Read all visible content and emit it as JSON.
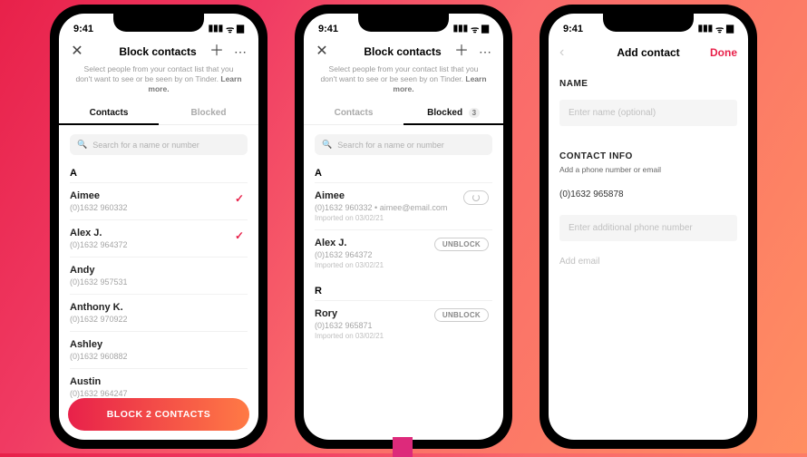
{
  "status_bar": {
    "time": "9:41"
  },
  "common": {
    "title": "Block contacts",
    "subtitle_a": "Select people from your contact list that you don't want to see or be seen by on Tinder.",
    "subtitle_b": "Select people from your contact list that you don't want to see or be seen by on Tinder.",
    "learn_more": "Learn more.",
    "tab_contacts": "Contacts",
    "tab_blocked": "Blocked",
    "blocked_count": "3",
    "search_placeholder": "Search for a name or number"
  },
  "screen1": {
    "sections": [
      {
        "letter": "A",
        "items": [
          {
            "name": "Aimee",
            "phone": "(0)1632 960332",
            "checked": true
          },
          {
            "name": "Alex J.",
            "phone": "(0)1632 964372",
            "checked": true
          },
          {
            "name": "Andy",
            "phone": "(0)1632 957531"
          },
          {
            "name": "Anthony K.",
            "phone": "(0)1632 970922"
          },
          {
            "name": "Ashley",
            "phone": "(0)1632 960882"
          },
          {
            "name": "Austin",
            "phone": "(0)1632 964247"
          }
        ]
      }
    ],
    "cta": "BLOCK 2 CONTACTS"
  },
  "screen2": {
    "unblock_label": "UNBLOCK",
    "sections": [
      {
        "letter": "A",
        "items": [
          {
            "name": "Aimee",
            "phone": "(0)1632 960332",
            "email": "aimee@email.com",
            "imported": "Imported on 03/02/21",
            "toggle": true
          },
          {
            "name": "Alex J.",
            "phone": "(0)1632 964372",
            "imported": "Imported on 03/02/21",
            "unblock": true
          }
        ]
      },
      {
        "letter": "R",
        "items": [
          {
            "name": "Rory",
            "phone": "(0)1632 965871",
            "imported": "Imported on 03/02/21",
            "unblock": true
          }
        ]
      }
    ]
  },
  "screen3": {
    "title": "Add contact",
    "done": "Done",
    "name_label": "NAME",
    "name_placeholder": "Enter name (optional)",
    "info_label": "CONTACT INFO",
    "info_sub": "Add a phone number or email",
    "prefill_phone": "(0)1632 965878",
    "additional_placeholder": "Enter additional phone number",
    "email_placeholder": "Add email"
  }
}
